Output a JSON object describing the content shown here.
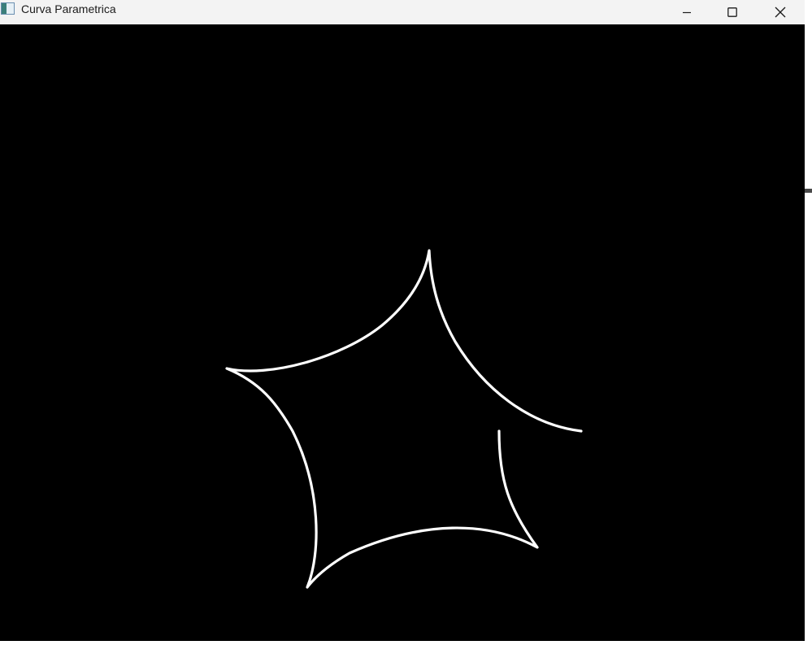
{
  "window": {
    "title": "Curva Parametrica",
    "app_icon": "app-window-icon",
    "controls": {
      "minimize_icon": "minimize-icon",
      "maximize_icon": "maximize-icon",
      "close_icon": "close-icon"
    }
  },
  "canvas": {
    "background_color": "#000000",
    "curve_color": "#ffffff"
  }
}
